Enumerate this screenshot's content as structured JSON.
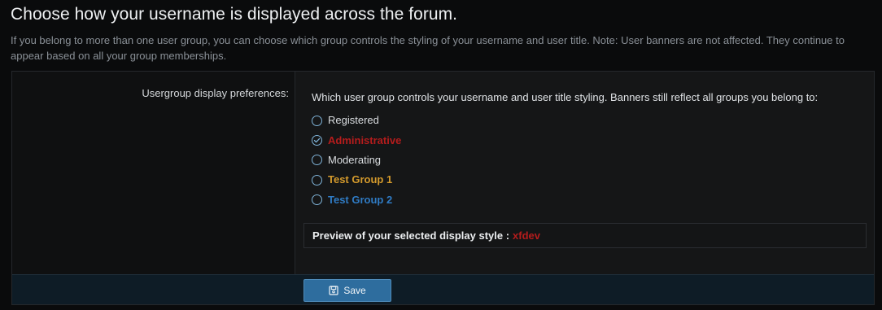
{
  "page": {
    "title": "Choose how your username is displayed across the forum.",
    "description": "If you belong to more than one user group, you can choose which group controls the styling of your username and user title. Note: User banners are not affected. They continue to appear based on all your group memberships."
  },
  "form": {
    "field_label": "Usergroup display preferences:",
    "explain": "Which user group controls your username and user title styling. Banners still reflect all groups you belong to:",
    "options": [
      {
        "label": "Registered",
        "selected": false,
        "color": "#dadde0",
        "bold": false
      },
      {
        "label": "Administrative",
        "selected": true,
        "color": "#b51c1c",
        "bold": true
      },
      {
        "label": "Moderating",
        "selected": false,
        "color": "#dadde0",
        "bold": false
      },
      {
        "label": "Test Group 1",
        "selected": false,
        "color": "#d49a2c",
        "bold": true
      },
      {
        "label": "Test Group 2",
        "selected": false,
        "color": "#2f7bc4",
        "bold": true
      }
    ],
    "preview": {
      "label": "Preview of your selected display style :",
      "username": "xfdev",
      "username_color": "#b51c1c"
    }
  },
  "footer": {
    "save_label": "Save",
    "save_icon": "save-icon"
  }
}
